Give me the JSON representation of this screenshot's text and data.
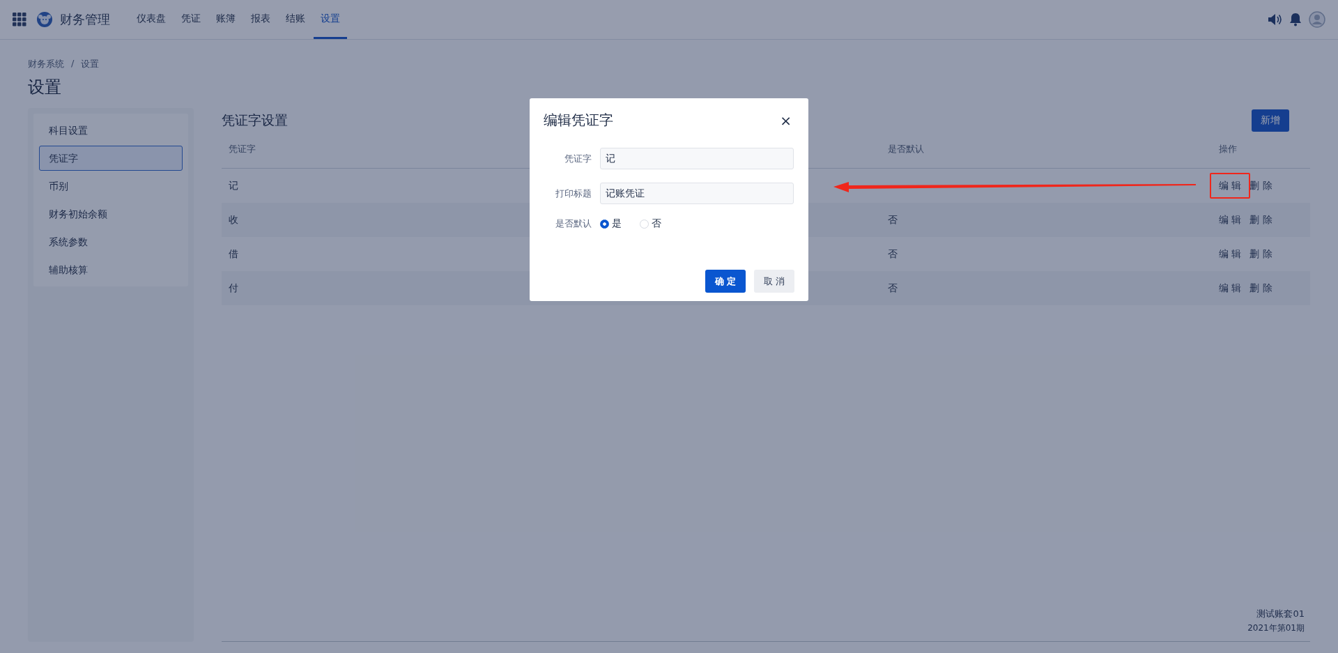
{
  "app": {
    "title": "财务管理"
  },
  "nav": [
    {
      "label": "仪表盘",
      "selected": false
    },
    {
      "label": "凭证",
      "selected": false
    },
    {
      "label": "账簿",
      "selected": false
    },
    {
      "label": "报表",
      "selected": false
    },
    {
      "label": "结账",
      "selected": false
    },
    {
      "label": "设置",
      "selected": true
    }
  ],
  "breadcrumb": [
    "财务系统",
    "/",
    "设置"
  ],
  "page_title": "设置",
  "sidebar": {
    "items": [
      {
        "label": "科目设置",
        "selected": false
      },
      {
        "label": "凭证字",
        "selected": true
      },
      {
        "label": "币别",
        "selected": false
      },
      {
        "label": "财务初始余额",
        "selected": false
      },
      {
        "label": "系统参数",
        "selected": false
      },
      {
        "label": "辅助核算",
        "selected": false
      }
    ]
  },
  "section": {
    "title": "凭证字设置",
    "add_button": "新增"
  },
  "table": {
    "columns": [
      "凭证字",
      "是否默认",
      "操作"
    ],
    "rows": [
      {
        "word": "记",
        "edit": "编 辑",
        "delete": "删 除"
      },
      {
        "word": "收",
        "default": "否",
        "edit": "编 辑",
        "delete": "删 除"
      },
      {
        "word": "借",
        "default": "否",
        "edit": "编 辑",
        "delete": "删 除"
      },
      {
        "word": "付",
        "default": "否",
        "edit": "编 辑",
        "delete": "删 除"
      }
    ]
  },
  "footer": {
    "account": "测试账套01",
    "period": "2021年第01期"
  },
  "dialog": {
    "title": "编辑凭证字",
    "close": "×",
    "fields": [
      {
        "label": "凭证字",
        "value": "记"
      },
      {
        "label": "打印标题",
        "value": "记账凭证"
      }
    ],
    "default_label": "是否默认",
    "options": [
      {
        "label": "是",
        "selected": true
      },
      {
        "label": "否",
        "selected": false
      }
    ],
    "buttons": [
      {
        "label": "确 定",
        "kind": "primary"
      },
      {
        "label": "取 消",
        "kind": "secondary"
      }
    ]
  }
}
